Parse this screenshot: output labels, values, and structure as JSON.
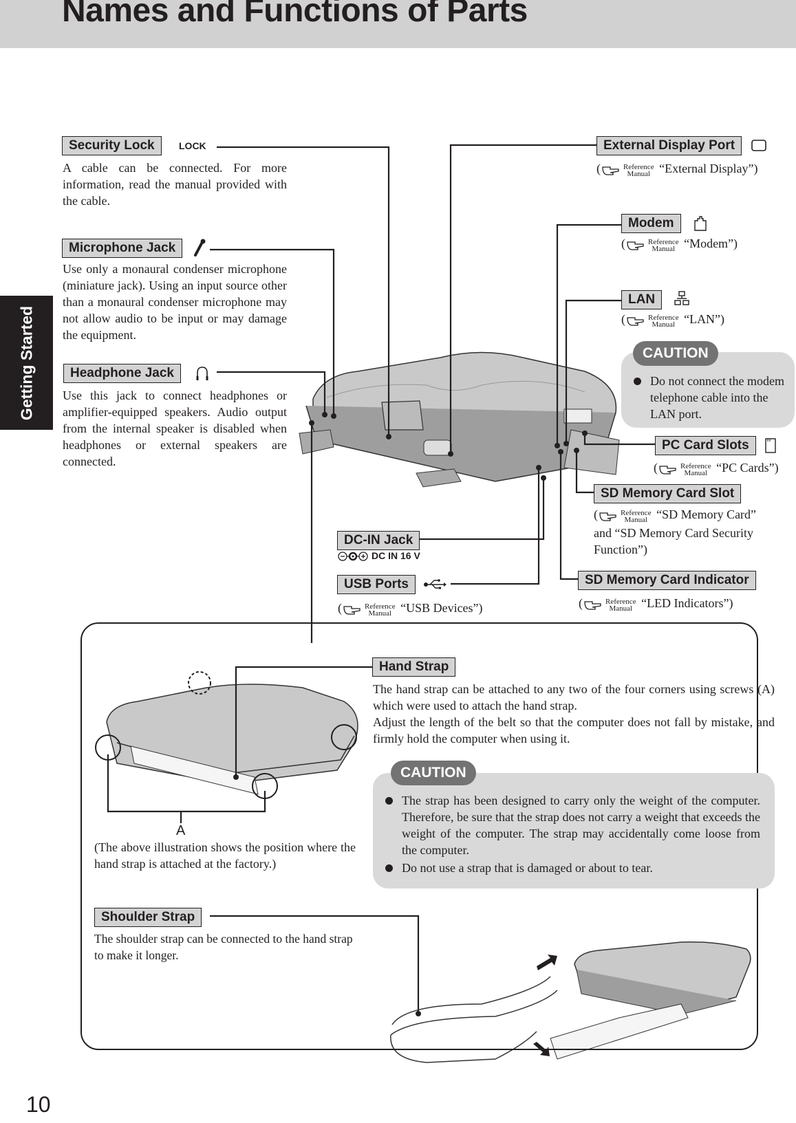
{
  "header": {
    "title": "Names and Functions of Parts"
  },
  "side_tab": {
    "label": "Getting Started"
  },
  "page_number": "10",
  "reference_mark": {
    "top": "Reference",
    "bottom": "Manual",
    "icon": "pointing-hand-icon"
  },
  "parts": {
    "security_lock": {
      "label": "Security Lock",
      "marking": "LOCK",
      "text": "A cable can be connected. For more information, read the manual provided with the cable."
    },
    "microphone_jack": {
      "label": "Microphone Jack",
      "icon": "microphone-icon",
      "text": "Use only a monaural condenser microphone (miniature jack). Using an input source other than a monaural condenser microphone may not allow audio to be input or may damage the equipment."
    },
    "headphone_jack": {
      "label": "Headphone Jack",
      "icon": "headphone-icon",
      "text": "Use this jack to connect headphones or amplifier-equipped speakers. Audio output from the internal speaker is disabled when headphones or external speakers are connected."
    },
    "external_display_port": {
      "label": "External Display Port",
      "icon": "monitor-icon",
      "ref_open": "(",
      "ref": "“External Display”)"
    },
    "modem": {
      "label": "Modem",
      "icon": "modem-jack-icon",
      "ref_open": "(",
      "ref": "“Modem”)"
    },
    "lan": {
      "label": "LAN",
      "icon": "network-icon",
      "ref_open": "(",
      "ref": "“LAN”)"
    },
    "pc_card_slots": {
      "label": "PC Card Slots",
      "icon": "pc-card-icon",
      "ref_open": "(",
      "ref": "“PC Cards”)"
    },
    "sd_memory_card_slot": {
      "label": "SD Memory Card Slot",
      "ref_open": "(",
      "ref": "“SD Memory Card”",
      "ref_cont1": "and “SD Memory Card Security",
      "ref_cont2": "Function”)"
    },
    "sd_memory_card_indicator": {
      "label": "SD Memory Card Indicator",
      "ref_open": "(",
      "ref": "“LED Indicators”)"
    },
    "dc_in_jack": {
      "label": "DC-IN Jack",
      "marking": "DC IN 16 V",
      "icon": "polarity-icon"
    },
    "usb_ports": {
      "label": "USB Ports",
      "icon": "usb-icon",
      "ref_open": "(",
      "ref": "“USB Devices”)"
    }
  },
  "caution_lan": {
    "title": "CAUTION",
    "items": [
      "Do not connect the modem telephone cable into the LAN port."
    ]
  },
  "hand_strap": {
    "label": "Hand Strap",
    "text1": "The hand strap can be attached to any two of the four corners using screws (A) which were used to attach the hand strap.",
    "text2": "Adjust the length of the belt so that the computer does not fall by mistake, and firmly hold the computer when using it.",
    "screw_label": "A",
    "illustration_note": "(The above illustration shows the position where the hand strap is attached at the factory.)"
  },
  "caution_strap": {
    "title": "CAUTION",
    "items": [
      "The strap has been designed to carry only the weight of the computer. Therefore, be sure that the strap does not carry a weight that exceeds the weight of the computer. The strap may accidentally come loose from the computer.",
      "Do not use a strap that is damaged or about to tear."
    ]
  },
  "shoulder_strap": {
    "label": "Shoulder Strap",
    "text": "The shoulder strap can be connected to the hand strap to make it longer."
  }
}
